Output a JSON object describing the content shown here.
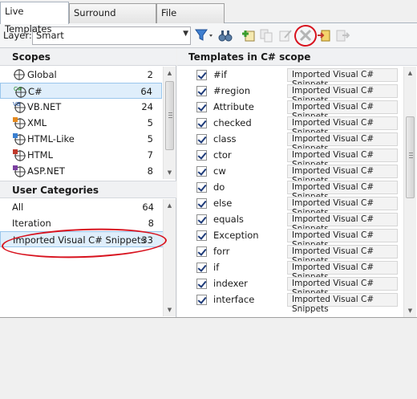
{
  "tabs": [
    {
      "label": "Live Templates",
      "active": true
    },
    {
      "label": "Surround Templates",
      "active": false
    },
    {
      "label": "File Templates",
      "active": false
    }
  ],
  "toolbar": {
    "layer_label": "Layer:",
    "layer_value": "Smart",
    "icons": [
      "filter-icon",
      "binoculars-icon",
      "new-template-icon",
      "copy-icon",
      "edit-icon",
      "delete-icon",
      "export-icon",
      "import-icon"
    ]
  },
  "scopes": {
    "heading": "Scopes",
    "items": [
      {
        "label": "Global",
        "count": "2",
        "icon": "globe-scope-icon"
      },
      {
        "label": "C#",
        "count": "64",
        "icon": "csharp-scope-icon",
        "selected": true
      },
      {
        "label": "VB.NET",
        "count": "24",
        "icon": "vbnet-scope-icon"
      },
      {
        "label": "XML",
        "count": "5",
        "icon": "xml-scope-icon"
      },
      {
        "label": "HTML-Like",
        "count": "5",
        "icon": "html-like-scope-icon"
      },
      {
        "label": "HTML",
        "count": "7",
        "icon": "html-scope-icon"
      },
      {
        "label": "ASP.NET",
        "count": "8",
        "icon": "aspnet-scope-icon"
      }
    ]
  },
  "categories": {
    "heading": "User Categories",
    "items": [
      {
        "label": "All",
        "count": "64"
      },
      {
        "label": "Iteration",
        "count": "8"
      },
      {
        "label": "Imported Visual C# Snippets",
        "count": "33",
        "selected": true
      }
    ]
  },
  "templates": {
    "heading": "Templates in C# scope",
    "items": [
      {
        "name": "#if",
        "category": "Imported Visual C# Snippets"
      },
      {
        "name": "#region",
        "category": "Imported Visual C# Snippets"
      },
      {
        "name": "Attribute",
        "category": "Imported Visual C# Snippets"
      },
      {
        "name": "checked",
        "category": "Imported Visual C# Snippets"
      },
      {
        "name": "class",
        "category": "Imported Visual C# Snippets"
      },
      {
        "name": "ctor",
        "category": "Imported Visual C# Snippets"
      },
      {
        "name": "cw",
        "category": "Imported Visual C# Snippets"
      },
      {
        "name": "do",
        "category": "Imported Visual C# Snippets"
      },
      {
        "name": "else",
        "category": "Imported Visual C# Snippets"
      },
      {
        "name": "equals",
        "category": "Imported Visual C# Snippets"
      },
      {
        "name": "Exception",
        "category": "Imported Visual C# Snippets"
      },
      {
        "name": "forr",
        "category": "Imported Visual C# Snippets"
      },
      {
        "name": "if",
        "category": "Imported Visual C# Snippets"
      },
      {
        "name": "indexer",
        "category": "Imported Visual C# Snippets"
      },
      {
        "name": "interface",
        "category": "Imported Visual C# Snippets"
      }
    ]
  },
  "colors": {
    "selection": "#dfeefb",
    "annotation_red": "#d8121e"
  }
}
